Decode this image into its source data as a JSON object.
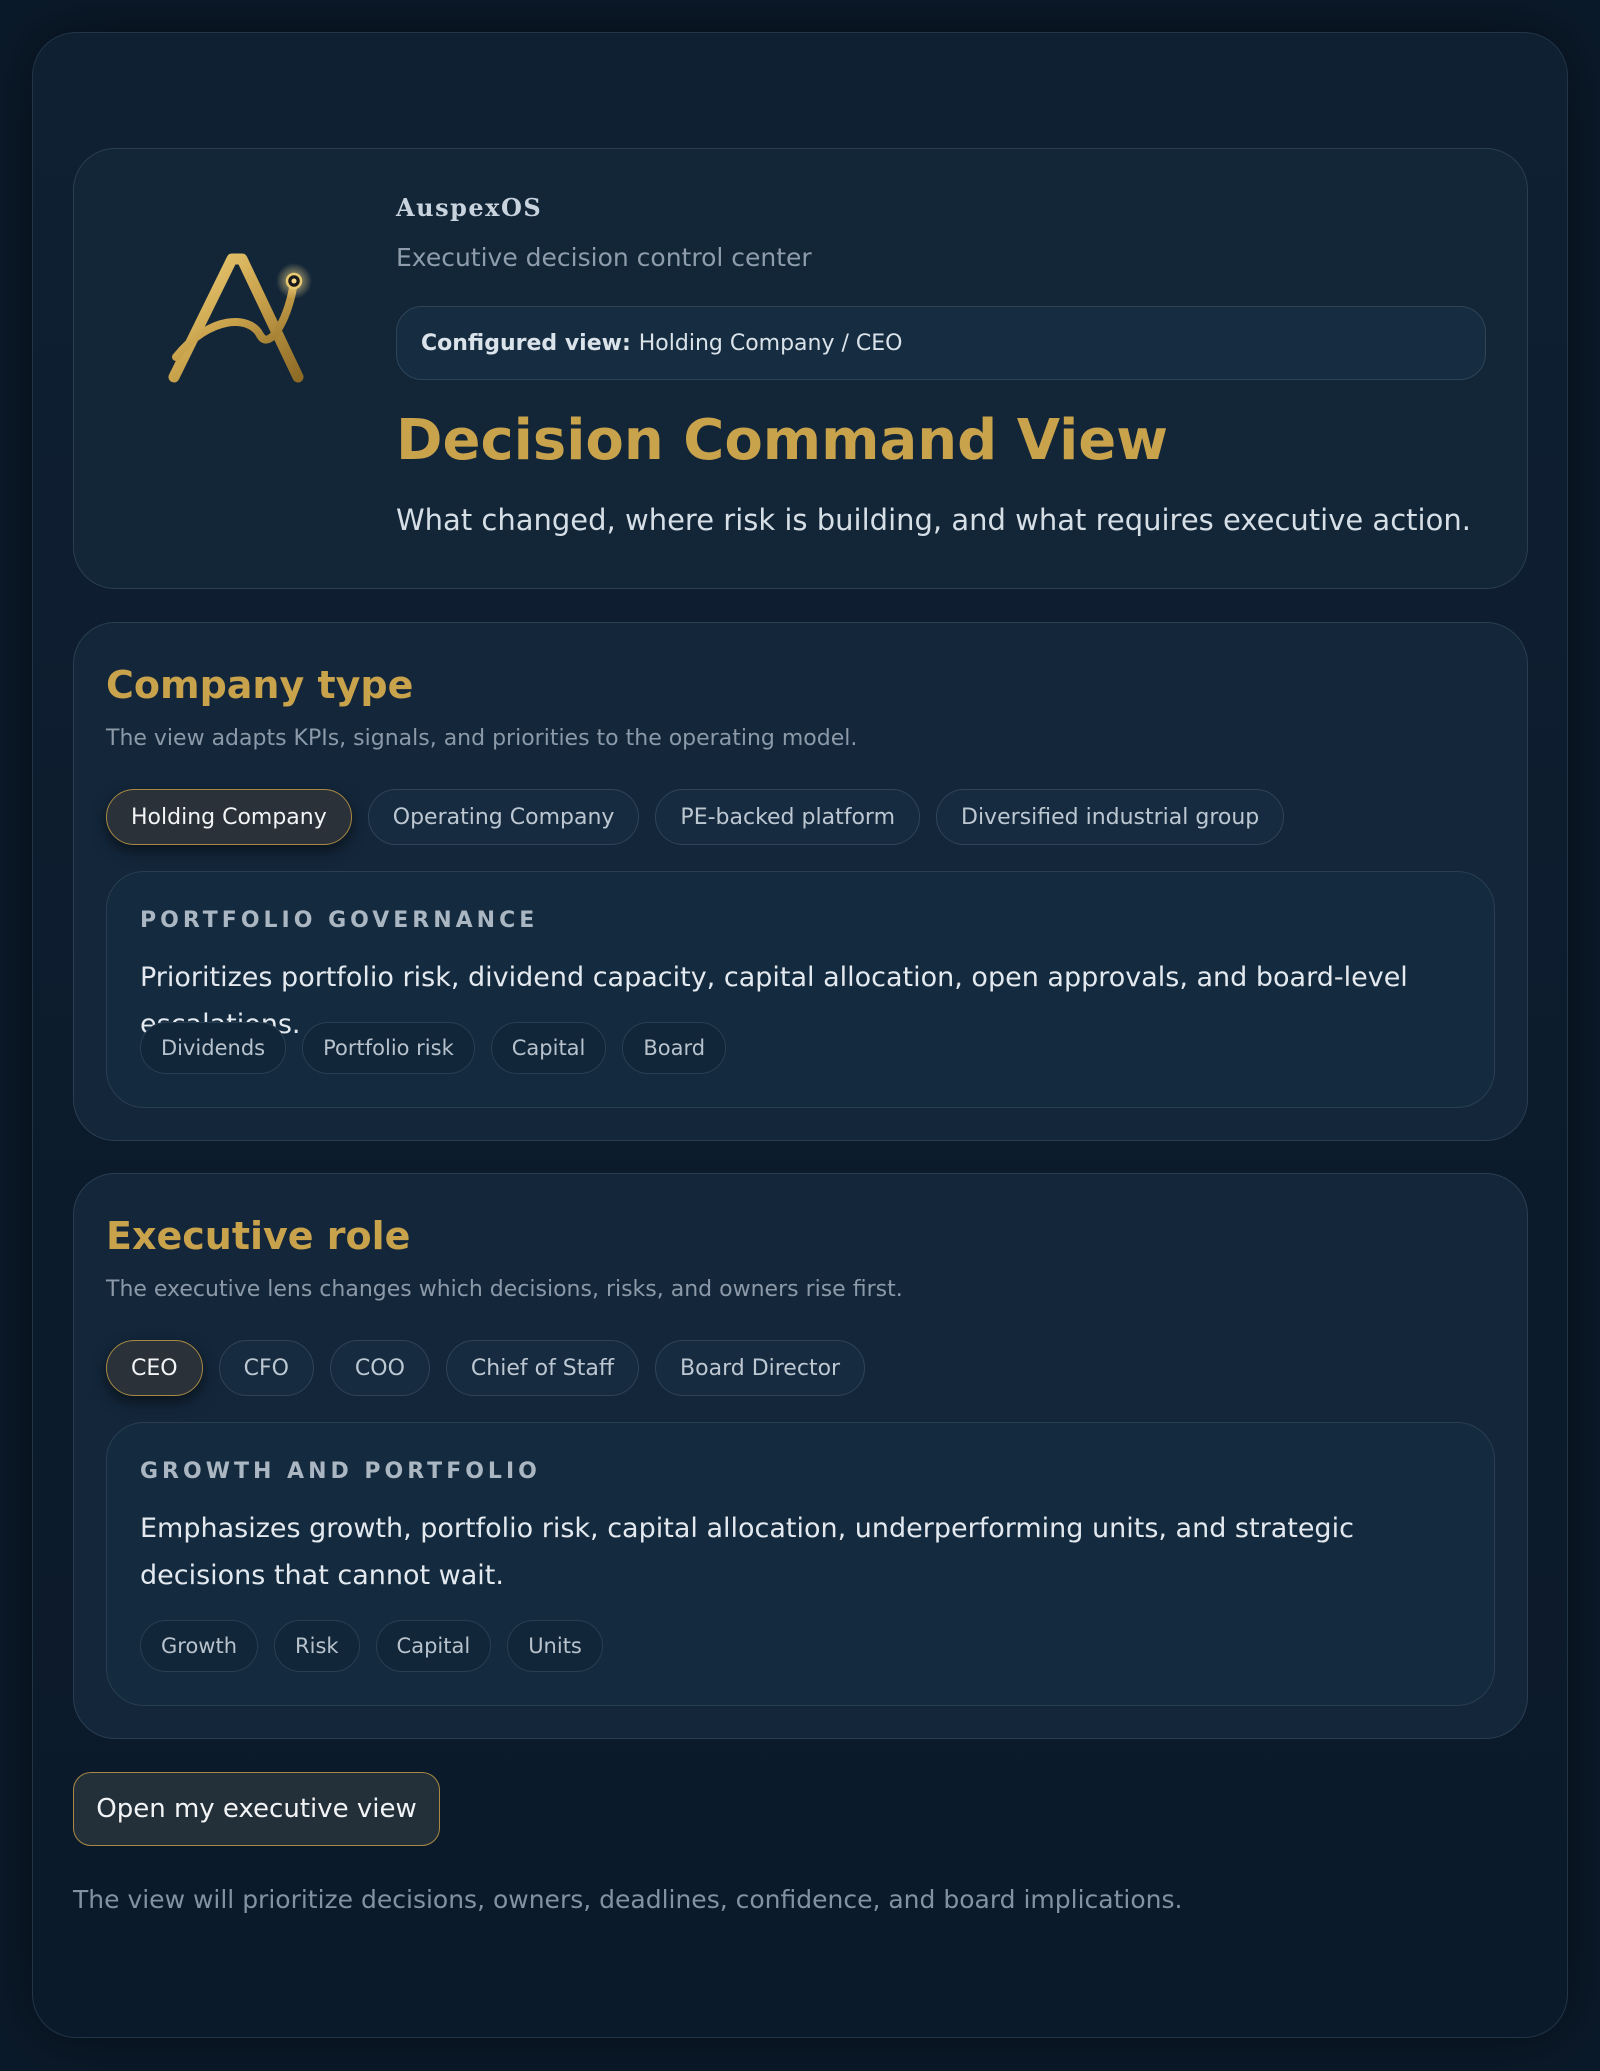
{
  "header": {
    "brand": "AuspexOS",
    "tagline": "Executive decision control center",
    "config_label": "Configured view:",
    "config_value": "Holding Company / CEO",
    "title": "Decision Command View",
    "subtitle": "What changed, where risk is building, and what requires executive action."
  },
  "company_type": {
    "title": "Company type",
    "description": "The view adapts KPIs, signals, and priorities to the operating model.",
    "options": [
      "Holding Company",
      "Operating Company",
      "PE-backed platform",
      "Diversified industrial group"
    ],
    "selected": "Holding Company",
    "detail": {
      "kicker": "PORTFOLIO GOVERNANCE",
      "text": "Prioritizes portfolio risk, dividend capacity, capital allocation, open approvals, and board-level escalations.",
      "tags": [
        "Dividends",
        "Portfolio risk",
        "Capital",
        "Board"
      ]
    }
  },
  "executive_role": {
    "title": "Executive role",
    "description": "The executive lens changes which decisions, risks, and owners rise first.",
    "options": [
      "CEO",
      "CFO",
      "COO",
      "Chief of Staff",
      "Board Director"
    ],
    "selected": "CEO",
    "detail": {
      "kicker": "GROWTH AND PORTFOLIO",
      "text": "Emphasizes growth, portfolio risk, capital allocation, underperforming units, and strategic decisions that cannot wait.",
      "tags": [
        "Growth",
        "Risk",
        "Capital",
        "Units"
      ]
    }
  },
  "cta_label": "Open my executive view",
  "footnote": "The view will prioritize decisions, owners, deadlines, confidence, and board implications.",
  "colors": {
    "accent_gold": "#c9a24c",
    "background": "#0b1a2a",
    "panel": "#13263a"
  }
}
